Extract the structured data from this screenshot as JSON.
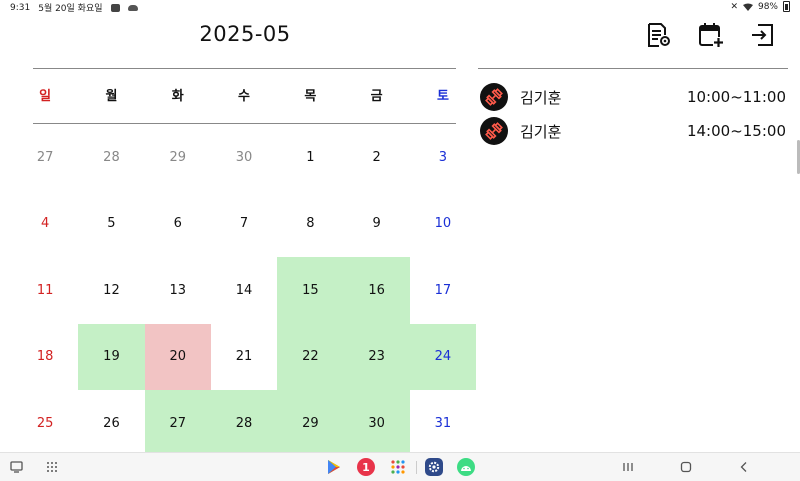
{
  "status_bar": {
    "time": "9:31",
    "date": "5월 20일 화요일",
    "battery": "98%",
    "icons": [
      "notification-icon",
      "cloud-icon",
      "mute-icon",
      "wifi-icon",
      "battery-icon"
    ]
  },
  "header": {
    "month": "2025-05",
    "actions": [
      "document-settings-icon",
      "calendar-add-icon",
      "exit-icon"
    ]
  },
  "weekdays": [
    "일",
    "월",
    "화",
    "수",
    "목",
    "금",
    "토"
  ],
  "calendar": {
    "rows": [
      [
        "27",
        "28",
        "29",
        "30",
        "1",
        "2",
        "3"
      ],
      [
        "4",
        "5",
        "6",
        "7",
        "8",
        "9",
        "10"
      ],
      [
        "11",
        "12",
        "13",
        "14",
        "15",
        "16",
        "17"
      ],
      [
        "18",
        "19",
        "20",
        "21",
        "22",
        "23",
        "24"
      ],
      [
        "25",
        "26",
        "27",
        "28",
        "29",
        "30",
        "31"
      ]
    ],
    "previous_month_days": [
      "27",
      "28",
      "29",
      "30"
    ],
    "booked_days": [
      "15",
      "16",
      "19",
      "22",
      "23",
      "24",
      "27",
      "28",
      "29",
      "30"
    ],
    "today": "20",
    "colors": {
      "sunday": "#d32222",
      "saturday": "#1a2fd6",
      "booked": "#c5f0c6",
      "today": "#f2c4c4"
    }
  },
  "schedule": [
    {
      "name": "김기훈",
      "time": "10:00~11:00",
      "icon": "dumbbell-icon"
    },
    {
      "name": "김기훈",
      "time": "14:00~15:00",
      "icon": "dumbbell-icon"
    }
  ],
  "navbar": {
    "apps": [
      "play-store-icon",
      "calendar-app-icon",
      "apps-grid-icon",
      "settings-app-icon",
      "android-app-icon"
    ],
    "calendar_app_badge": "1",
    "buttons": [
      "recent-apps-button",
      "home-button",
      "back-button"
    ]
  }
}
